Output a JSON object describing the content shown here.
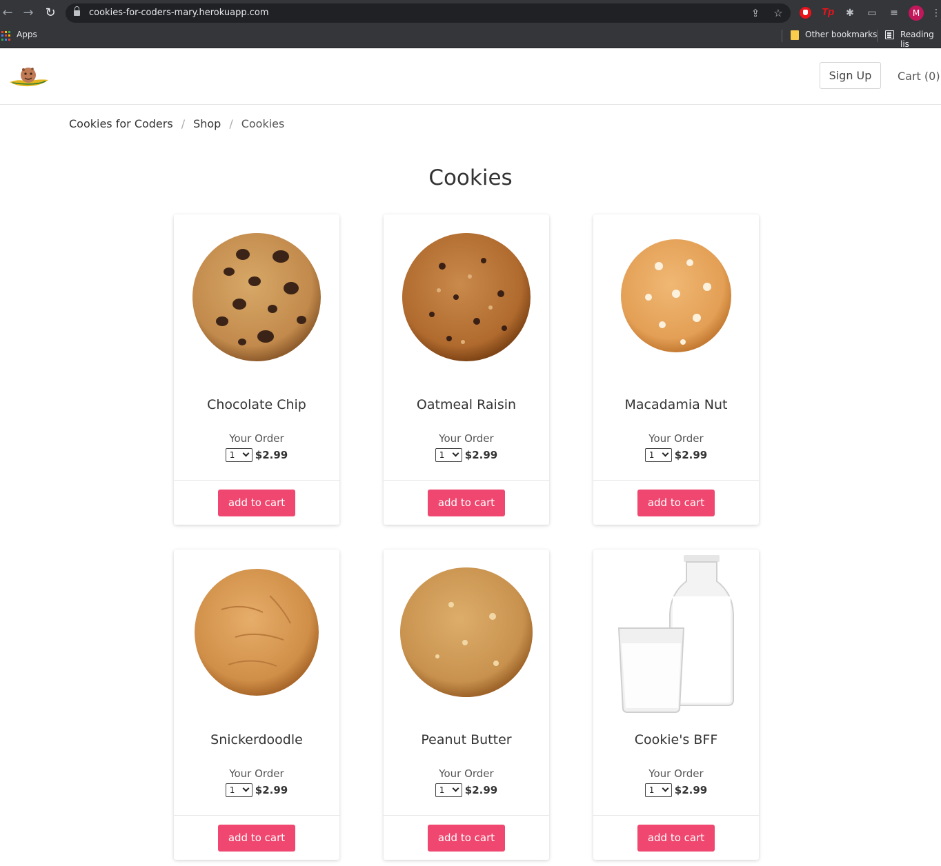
{
  "browser": {
    "url": "cookies-for-coders-mary.herokuapp.com",
    "avatar_letter": "M",
    "bookmarks": {
      "apps_label": "Apps",
      "other_label": "Other bookmarks",
      "reading_label": "Reading lis"
    },
    "ext_tp_label": "Tp"
  },
  "header": {
    "signup_label": "Sign Up",
    "cart_label": "Cart (0)"
  },
  "breadcrumb": {
    "items": [
      "Cookies for Coders",
      "Shop",
      "Cookies"
    ]
  },
  "page": {
    "title": "Cookies"
  },
  "colors": {
    "accent": "#ef476f",
    "chrome_bg": "#35363a"
  },
  "products": [
    {
      "name": "Chocolate Chip",
      "order_label": "Your Order",
      "qty": "1",
      "price": "$2.99",
      "button": "add to cart",
      "image": "chocolate-chip-cookie"
    },
    {
      "name": "Oatmeal Raisin",
      "order_label": "Your Order",
      "qty": "1",
      "price": "$2.99",
      "button": "add to cart",
      "image": "oatmeal-raisin-cookie"
    },
    {
      "name": "Macadamia Nut",
      "order_label": "Your Order",
      "qty": "1",
      "price": "$2.99",
      "button": "add to cart",
      "image": "macadamia-nut-cookie"
    },
    {
      "name": "Snickerdoodle",
      "order_label": "Your Order",
      "qty": "1",
      "price": "$2.99",
      "button": "add to cart",
      "image": "snickerdoodle-cookie"
    },
    {
      "name": "Peanut Butter",
      "order_label": "Your Order",
      "qty": "1",
      "price": "$2.99",
      "button": "add to cart",
      "image": "peanut-butter-cookie"
    },
    {
      "name": "Cookie's BFF",
      "order_label": "Your Order",
      "qty": "1",
      "price": "$2.99",
      "button": "add to cart",
      "image": "milk-bottle-and-glass"
    }
  ]
}
